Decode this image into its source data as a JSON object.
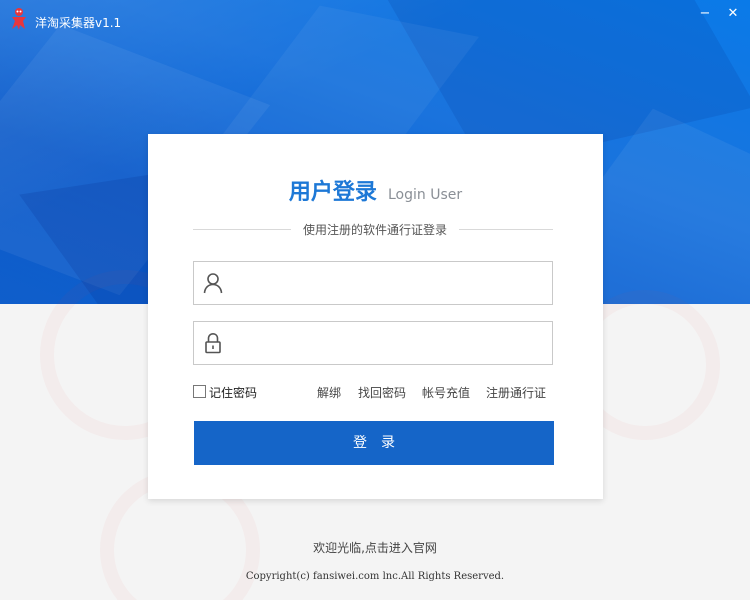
{
  "window": {
    "title": "洋淘采集器v1.1",
    "minimize_label": "−",
    "close_label": "✕"
  },
  "login": {
    "heading_cn": "用户登录",
    "heading_en": "Login User",
    "subtitle": "使用注册的软件通行证登录",
    "username": {
      "value": "",
      "placeholder": "",
      "icon": "user-icon"
    },
    "password": {
      "value": "",
      "placeholder": "",
      "icon": "lock-icon"
    },
    "remember_label": "记住密码",
    "remember_checked": false,
    "links": {
      "unbind": "解绑",
      "recover": "找回密码",
      "recharge": "帐号充值",
      "register": "注册通行证"
    },
    "button_label": "登录"
  },
  "footer": {
    "welcome": "欢迎光临,点击进入官网",
    "copyright": "Copyright(c) fansiwei.com lnc.All Rights Reserved."
  },
  "colors": {
    "header_blue": "#1a73dd",
    "button_blue": "#1565c8",
    "heading_blue": "#1d78d6",
    "logo_red": "#e8363c"
  }
}
